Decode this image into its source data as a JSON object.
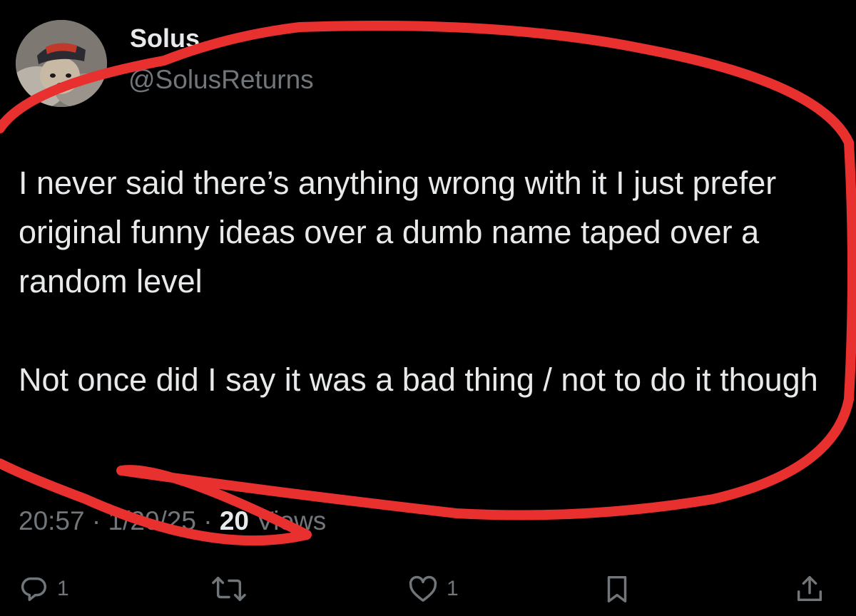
{
  "author": {
    "display_name": "Solus",
    "handle": "@SolusReturns",
    "avatar_icon": "avatar-dog-in-cap"
  },
  "tweet": {
    "paragraphs": [
      "I never said there’s anything wrong with it I just prefer original funny ideas over a dumb name taped over a random level",
      "Not once did I say it was a bad thing / not to do it though"
    ],
    "time": "20:57",
    "separator": "·",
    "date": "1/20/25",
    "views_count": "20",
    "views_label": "Views"
  },
  "actions": {
    "reply_count": "1",
    "like_count": "1",
    "icons": [
      "reply-icon",
      "retweet-icon",
      "like-icon",
      "bookmark-icon",
      "share-icon"
    ]
  },
  "annotation": {
    "color": "#e8302f"
  }
}
